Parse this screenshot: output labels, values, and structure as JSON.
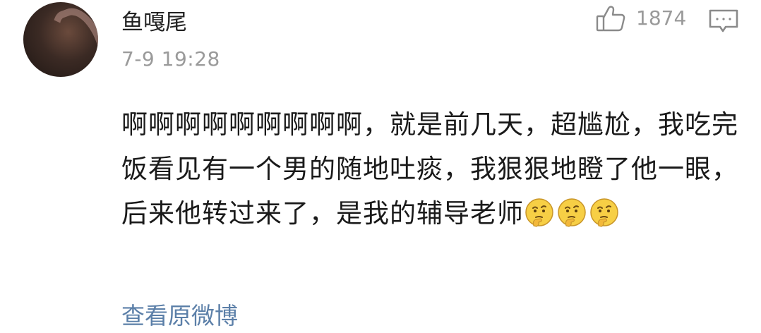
{
  "comment": {
    "username": "鱼嘎尾",
    "timestamp": "7-9 19:28",
    "like_count": "1874",
    "text": "啊啊啊啊啊啊啊啊啊，就是前几天，超尴尬，我吃完饭看见有一个男的随地吐痰，我狠狠地瞪了他一眼，后来他转过来了，是我的辅导老师",
    "emojis": [
      "thinking-emoji",
      "thinking-emoji",
      "thinking-emoji"
    ],
    "view_original_label": "查看原微博"
  },
  "icons": {
    "like": "thumbs-up-icon",
    "reply": "comment-bubble-icon"
  },
  "colors": {
    "link": "#5b7fa8",
    "meta_text": "#9a9a9a",
    "icon_stroke": "#8a8a8a"
  }
}
